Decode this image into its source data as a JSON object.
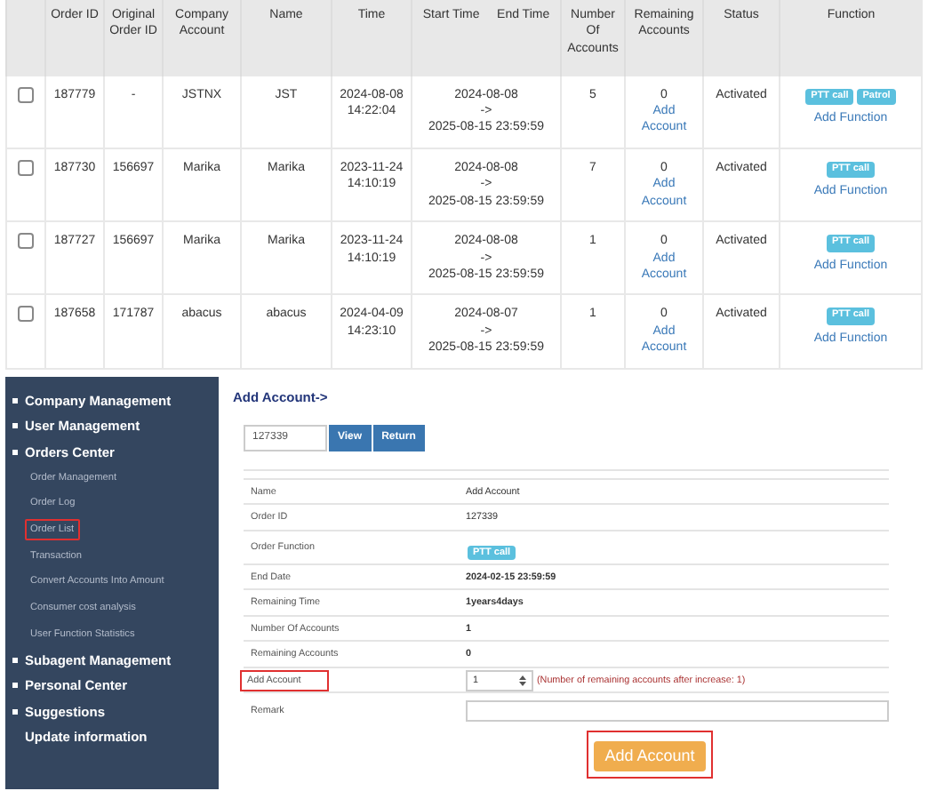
{
  "orders_table": {
    "columns": [
      {
        "kind": "check"
      },
      {
        "kind": "text",
        "label": "Order ID"
      },
      {
        "kind": "text",
        "label": "Original Order ID"
      },
      {
        "kind": "text",
        "label": "Company Account"
      },
      {
        "kind": "text",
        "label": "Name"
      },
      {
        "kind": "text",
        "label": "Time"
      },
      {
        "kind": "pair",
        "labels": [
          "Start Time",
          "End Time"
        ]
      },
      {
        "kind": "text",
        "label": "Number Of Accounts"
      },
      {
        "kind": "text",
        "label": "Remaining Accounts"
      },
      {
        "kind": "text",
        "label": "Status"
      },
      {
        "kind": "text",
        "label": "Function"
      }
    ],
    "rows": [
      {
        "checked": false,
        "order_id": "187779",
        "original_order_id": "-",
        "company_account": "JSTNX",
        "name": "JST",
        "time": "2024-08-08 14:22:04",
        "start": "2024-08-08",
        "arrow": "->",
        "end": "2025-08-15 23:59:59",
        "number": "5",
        "remaining": "0",
        "add_account": "Add Account",
        "status": "Activated",
        "functions": [
          "PTT call",
          "Patrol"
        ],
        "add_function": "Add Function"
      },
      {
        "checked": false,
        "order_id": "187730",
        "original_order_id": "156697",
        "company_account": "Marika",
        "name": "Marika",
        "time": "2023-11-24 14:10:19",
        "start": "2024-08-08",
        "arrow": "->",
        "end": "2025-08-15 23:59:59",
        "number": "7",
        "remaining": "0",
        "add_account": "Add Account",
        "status": "Activated",
        "functions": [
          "PTT call"
        ],
        "add_function": "Add Function"
      },
      {
        "checked": false,
        "order_id": "187727",
        "original_order_id": "156697",
        "company_account": "Marika",
        "name": "Marika",
        "time": "2023-11-24 14:10:19",
        "start": "2024-08-08",
        "arrow": "->",
        "end": "2025-08-15 23:59:59",
        "number": "1",
        "remaining": "0",
        "add_account": "Add Account",
        "status": "Activated",
        "functions": [
          "PTT call"
        ],
        "add_function": "Add Function"
      },
      {
        "checked": false,
        "order_id": "187658",
        "original_order_id": "171787",
        "company_account": "abacus",
        "name": "abacus",
        "time": "2024-04-09 14:23:10",
        "start": "2024-08-07",
        "arrow": "->",
        "end": "2025-08-15 23:59:59",
        "number": "1",
        "remaining": "0",
        "add_account": "Add Account",
        "status": "Activated",
        "functions": [
          "PTT call"
        ],
        "add_function": "Add Function"
      }
    ]
  },
  "sidebar": {
    "items": [
      {
        "kind": "group",
        "label": "Company Management"
      },
      {
        "kind": "group",
        "label": "User Management"
      },
      {
        "kind": "group",
        "label": "Orders Center",
        "children": [
          {
            "label": "Order Management",
            "highlighted": false
          },
          {
            "label": "Order Log",
            "highlighted": false
          },
          {
            "label": "Order List",
            "highlighted": true
          },
          {
            "label": "Transaction",
            "highlighted": false
          },
          {
            "label": "Convert Accounts Into Amount",
            "highlighted": false
          },
          {
            "label": "Consumer cost analysis",
            "highlighted": false
          },
          {
            "label": "User Function Statistics",
            "highlighted": false
          }
        ]
      },
      {
        "kind": "group",
        "label": "Subagent Management"
      },
      {
        "kind": "group",
        "label": "Personal Center"
      },
      {
        "kind": "group",
        "label": "Suggestions"
      },
      {
        "kind": "link",
        "label": "Update information"
      }
    ]
  },
  "add_account_form": {
    "title": "Add Account->",
    "order_field": {
      "value": "127339"
    },
    "buttons": [
      "View",
      "Return"
    ],
    "details": [
      {
        "kind": "text",
        "label": "Name",
        "value": "Add Account",
        "bold": false,
        "highlighted": false
      },
      {
        "kind": "text",
        "label": "Order ID",
        "value": "127339",
        "bold": false,
        "highlighted": false
      },
      {
        "kind": "tag",
        "label": "Order Function",
        "value": "PTT call",
        "highlighted": false
      },
      {
        "kind": "text",
        "label": "End Date",
        "value": "2024-02-15 23:59:59",
        "bold": true,
        "highlighted": false
      },
      {
        "kind": "text",
        "label": "Remaining Time",
        "value": "1years4days",
        "bold": true,
        "highlighted": false
      },
      {
        "kind": "text",
        "label": "Number Of Accounts",
        "value": "1",
        "bold": true,
        "highlighted": false
      },
      {
        "kind": "text",
        "label": "Remaining Accounts",
        "value": "0",
        "bold": true,
        "highlighted": false
      },
      {
        "kind": "spinner",
        "label": "Add Account",
        "value": "1",
        "note": "(Number of remaining accounts after increase: 1)",
        "highlighted": true
      },
      {
        "kind": "input",
        "label": "Remark",
        "highlighted": false
      }
    ],
    "submit": {
      "label": "Add Account",
      "highlighted": true
    }
  }
}
